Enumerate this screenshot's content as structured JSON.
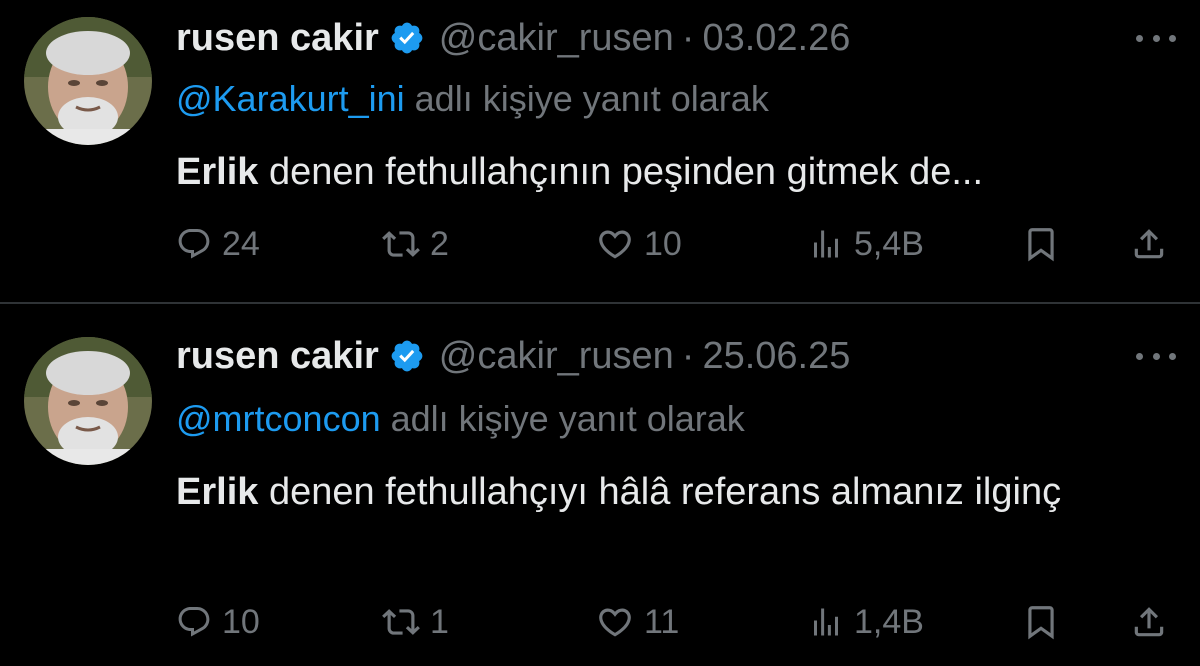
{
  "tweets": [
    {
      "display_name": "rusen cakir",
      "handle": "@cakir_rusen",
      "separator": "·",
      "date": "03.02.26",
      "reply_to_handle": "@Karakurt_ini",
      "reply_suffix": "adlı kişiye yanıt olarak",
      "text_bold": "Erlik",
      "text_rest": " denen fethullahçının peşinden gitmek de...",
      "replies": "24",
      "retweets": "2",
      "likes": "10",
      "views": "5,4B"
    },
    {
      "display_name": "rusen cakir",
      "handle": "@cakir_rusen",
      "separator": "·",
      "date": "25.06.25",
      "reply_to_handle": "@mrtconcon",
      "reply_suffix": "adlı kişiye yanıt olarak",
      "text_bold": "Erlik",
      "text_rest": " denen fethullahçıyı hâlâ referans almanız ilginç",
      "replies": "10",
      "retweets": "1",
      "likes": "11",
      "views": "1,4B"
    }
  ],
  "colors": {
    "background": "#000000",
    "primary_text": "#e7e9ea",
    "secondary_text": "#71767b",
    "link": "#1d9bf0",
    "verified_badge": "#1d9bf0",
    "divider": "#2f3336"
  },
  "icons": [
    "verified-badge-icon",
    "more-options-icon",
    "reply-icon",
    "retweet-icon",
    "like-icon",
    "views-icon",
    "bookmark-icon",
    "share-icon"
  ]
}
